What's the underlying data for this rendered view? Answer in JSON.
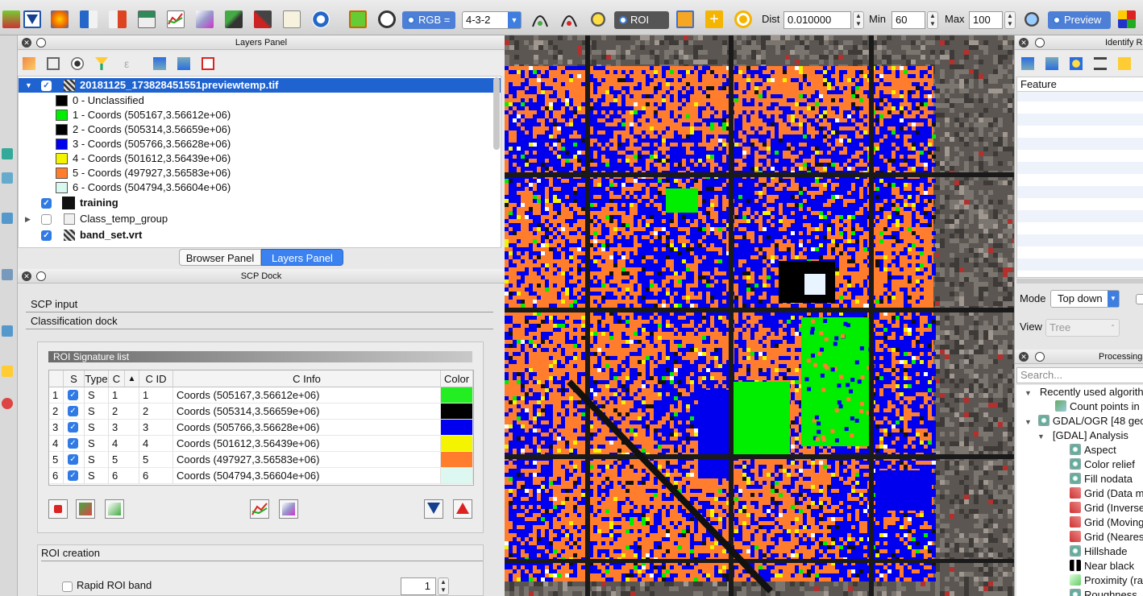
{
  "toolbar": {
    "rgb_label": "RGB =",
    "band_combo": "4-3-2",
    "roi_label": "ROI",
    "dist_label": "Dist",
    "dist_value": "0.010000",
    "min_label": "Min",
    "min_value": "60",
    "max_label": "Max",
    "max_value": "100",
    "preview_label": "Preview"
  },
  "layers_panel": {
    "title": "Layers Panel",
    "root_layer": "20181125_173828451551previewtemp.tif",
    "classes": [
      {
        "label": "0 - Unclassified",
        "color": "#000000"
      },
      {
        "label": "1 - Coords (505167,3.56612e+06)",
        "color": "#00ee00"
      },
      {
        "label": "2 - Coords (505314,3.56659e+06)",
        "color": "#000000"
      },
      {
        "label": "3 - Coords (505766,3.56628e+06)",
        "color": "#0000ee"
      },
      {
        "label": "4 - Coords (501612,3.56439e+06)",
        "color": "#f4f400"
      },
      {
        "label": "5 - Coords (497927,3.56583e+06)",
        "color": "#ff7d2d"
      },
      {
        "label": "6 - Coords (504794,3.56604e+06)",
        "color": "#d8f8f0"
      }
    ],
    "other_layers": [
      {
        "label": "training",
        "checked": true
      },
      {
        "label": "Class_temp_group",
        "checked": false
      },
      {
        "label": "band_set.vrt",
        "checked": true
      }
    ],
    "tabs": [
      "Browser Panel",
      "Layers Panel"
    ]
  },
  "scp_dock": {
    "title": "SCP Dock",
    "sections": [
      "SCP input",
      "Classification dock"
    ],
    "roi_list_title": "ROI Signature list",
    "columns": [
      "S",
      "Type",
      "C",
      "▲",
      "C ID",
      "C Info",
      "Color"
    ],
    "rows": [
      {
        "n": "1",
        "type": "S",
        "c": "1",
        "cid": "1",
        "info": "Coords (505167,3.56612e+06)",
        "color": "#22ee22"
      },
      {
        "n": "2",
        "type": "S",
        "c": "2",
        "cid": "2",
        "info": "Coords (505314,3.56659e+06)",
        "color": "#000000"
      },
      {
        "n": "3",
        "type": "S",
        "c": "3",
        "cid": "3",
        "info": "Coords (505766,3.56628e+06)",
        "color": "#0000ee"
      },
      {
        "n": "4",
        "type": "S",
        "c": "4",
        "cid": "4",
        "info": "Coords (501612,3.56439e+06)",
        "color": "#f4f400"
      },
      {
        "n": "5",
        "type": "S",
        "c": "5",
        "cid": "5",
        "info": "Coords (497927,3.56583e+06)",
        "color": "#ff7d2d"
      },
      {
        "n": "6",
        "type": "S",
        "c": "6",
        "cid": "6",
        "info": "Coords (504794,3.56604e+06)",
        "color": "#dcf8f0"
      }
    ],
    "roi_creation": "ROI creation",
    "rapid_roi_band": "Rapid ROI band",
    "rapid_roi_value": "1"
  },
  "identify": {
    "title": "Identify R",
    "feature_header": "Feature",
    "mode_label": "Mode",
    "mode_value": "Top down",
    "view_label": "View",
    "view_value": "Tree"
  },
  "processing": {
    "title": "Processing",
    "search_placeholder": "Search...",
    "items": [
      {
        "label": "Recently used algorithm",
        "depth": 0,
        "icon": "arrow"
      },
      {
        "label": "Count points in",
        "depth": 2,
        "icon": "vector"
      },
      {
        "label": "GDAL/OGR [48 geo",
        "depth": 0,
        "icon": "gdal"
      },
      {
        "label": "[GDAL] Analysis",
        "depth": 1,
        "icon": "arrow"
      },
      {
        "label": "Aspect",
        "depth": 3,
        "icon": "gdal"
      },
      {
        "label": "Color relief",
        "depth": 3,
        "icon": "gdal"
      },
      {
        "label": "Fill nodata",
        "depth": 3,
        "icon": "gdal"
      },
      {
        "label": "Grid (Data m",
        "depth": 3,
        "icon": "grid"
      },
      {
        "label": "Grid (Inverse",
        "depth": 3,
        "icon": "grid"
      },
      {
        "label": "Grid (Moving",
        "depth": 3,
        "icon": "grid"
      },
      {
        "label": "Grid (Neares",
        "depth": 3,
        "icon": "grid"
      },
      {
        "label": "Hillshade",
        "depth": 3,
        "icon": "gdal"
      },
      {
        "label": "Near black",
        "depth": 3,
        "icon": "black"
      },
      {
        "label": "Proximity (ra",
        "depth": 3,
        "icon": "prox"
      },
      {
        "label": "Roughness",
        "depth": 3,
        "icon": "gdal"
      }
    ]
  },
  "colors": {
    "selection": "#1e63d0",
    "orange": "#ff7d2d",
    "blue": "#0000ee",
    "green": "#00ee00"
  }
}
